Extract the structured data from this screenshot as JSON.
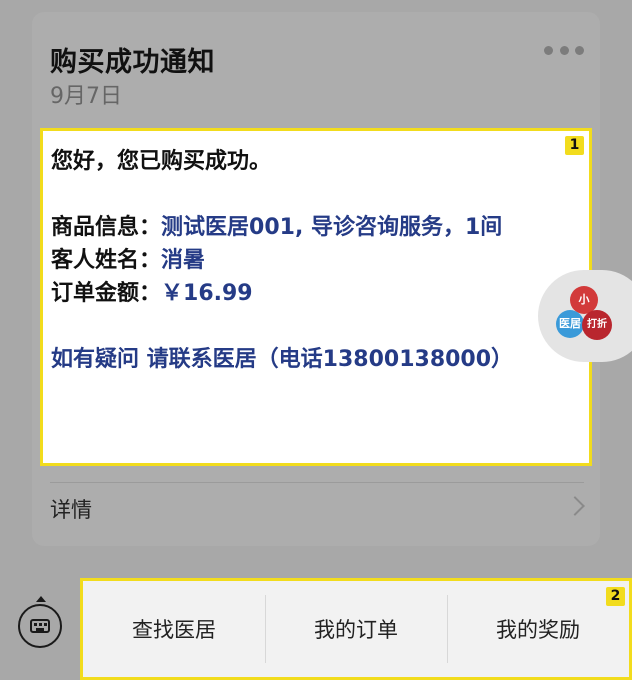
{
  "card": {
    "title": "购买成功通知",
    "date": "9月7日",
    "message": {
      "greeting": "您好，您已购买成功。",
      "product_label": "商品信息：",
      "product_value": "测试医居001, 导诊咨询服务，1间",
      "guest_label": "客人姓名：",
      "guest_value": "消暑",
      "amount_label": "订单金额：",
      "amount_value": "￥16.99",
      "contact": "如有疑问 请联系医居（电话13800138000）"
    },
    "detail_label": "详情"
  },
  "floating_widget": {
    "text_top": "小",
    "text_left": "医居",
    "text_right": "打折"
  },
  "badges": [
    "1",
    "2"
  ],
  "bottom_menu": {
    "items": [
      {
        "label": "查找医居"
      },
      {
        "label": "我的订单"
      },
      {
        "label": "我的奖励"
      }
    ]
  },
  "colors": {
    "highlight": "#f2dc1d",
    "link_blue": "#253b86",
    "overlay_bg": "#a8a8a8"
  }
}
